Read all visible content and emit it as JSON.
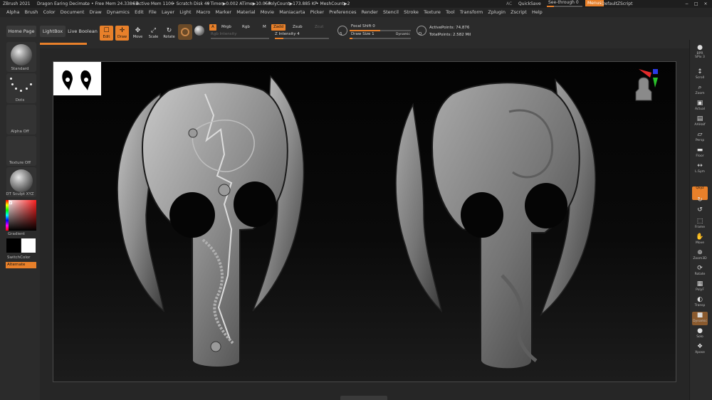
{
  "titlebar": {
    "app": "ZBrush 2021",
    "document": "Dragon Earing Decimate",
    "dots": "..",
    "free_mem": "• Free Mem 24.338GB",
    "active_mem": "• Active Mem 1106",
    "scratch": "• Scratch Disk 49",
    "timer": "• Timer▶0.002 ATime▶10.054",
    "polycount": "• PolyCount▶173.885 KP",
    "meshcount": "• MeshCount▶2",
    "ac": "AC",
    "quicksave": "QuickSave",
    "see_through": "See-through   0",
    "see_through_value": 0.2,
    "menus": "Menus",
    "default_script": "DefaultZScript",
    "win_controls": "− □ ×"
  },
  "menubar": [
    "Alpha",
    "Brush",
    "Color",
    "Document",
    "Draw",
    "Dynamics",
    "Edit",
    "File",
    "Layer",
    "Light",
    "Macro",
    "Marker",
    "Material",
    "Movie",
    "Maniacarta",
    "Picker",
    "Preferences",
    "Render",
    "Stencil",
    "Stroke",
    "Texture",
    "Tool",
    "Transform",
    "Zplugin",
    "Zscript",
    "Help"
  ],
  "toolbar": {
    "home_page": "Home Page",
    "lightbox": "LightBox",
    "live_boolean": "Live Boolean",
    "tools": [
      {
        "glyph": "☐",
        "label": "Edit"
      },
      {
        "glyph": "✛",
        "label": "Draw"
      },
      {
        "glyph": "✥",
        "label": "Move"
      },
      {
        "glyph": "⤢",
        "label": "Scale"
      },
      {
        "glyph": "↻",
        "label": "Rotate"
      }
    ],
    "a_label": "A",
    "mrgb": "Mrgb",
    "rgb": "Rgb",
    "m": "M",
    "rgb_intensity": "Rgb Intensity",
    "zadd": "Zadd",
    "zsub": "Zsub",
    "zcut": "Zcut",
    "z_intensity": "Z Intensity 4",
    "z_intensity_value": 0.16,
    "focal_shift": "Focal Shift 0",
    "focal_shift_value": 0.5,
    "draw_size": "Draw Size 1",
    "draw_size_value": 0.05,
    "dynamic": "Dynamic",
    "s_label": "S",
    "d_label": "D",
    "active_points": "ActivePoints: 74,876",
    "total_points": "TotalPoints: 2.582 Mil"
  },
  "leftshelf": {
    "standard": "Standard",
    "dots": "Dots",
    "alpha_off": "Alpha Off",
    "texture_off": "Texture Off",
    "material": "DT Sculpt XYZ",
    "gradient": "Gradient",
    "switch_color": "SwitchColor",
    "alternate": "Alternate",
    "colors": {
      "main": "#ffffff",
      "secondary": "#000000",
      "accent": "#e8802a"
    }
  },
  "rightshelf": [
    {
      "name": "bpr",
      "glyph": "●",
      "label": "BPR"
    },
    {
      "name": "spix",
      "glyph": "",
      "label": "SPix 3"
    },
    {
      "name": "scroll",
      "glyph": "↕",
      "label": "Scroll"
    },
    {
      "name": "zoom",
      "glyph": "⌕",
      "label": "Zoom"
    },
    {
      "name": "actual",
      "glyph": "▣",
      "label": "Actual"
    },
    {
      "name": "aahalf",
      "glyph": "▤",
      "label": "AAHalf"
    },
    {
      "name": "persp",
      "glyph": "▱",
      "label": "Persp"
    },
    {
      "name": "floor",
      "glyph": "▬",
      "label": "Floor"
    },
    {
      "name": "lsym",
      "glyph": "↔",
      "label": "L.Sym"
    },
    {
      "name": "xyz",
      "glyph": "",
      "label": "Qxyz"
    },
    {
      "name": "rot-y",
      "glyph": "↻",
      "label": ""
    },
    {
      "name": "rot-z",
      "glyph": "↺",
      "label": ""
    },
    {
      "name": "frame",
      "glyph": "⬚",
      "label": "Frame"
    },
    {
      "name": "move",
      "glyph": "✋",
      "label": "Move"
    },
    {
      "name": "zoom3d",
      "glyph": "⊕",
      "label": "Zoom3D"
    },
    {
      "name": "rotate",
      "glyph": "⟳",
      "label": "Rotate"
    },
    {
      "name": "polyf",
      "glyph": "▦",
      "label": "PolyF"
    },
    {
      "name": "transp",
      "glyph": "◐",
      "label": "Transp"
    },
    {
      "name": "dynamic",
      "glyph": "■",
      "label": "Dynamic"
    },
    {
      "name": "solo",
      "glyph": "●",
      "label": "Solo"
    },
    {
      "name": "xpose",
      "glyph": "❖",
      "label": "Xpose"
    }
  ]
}
